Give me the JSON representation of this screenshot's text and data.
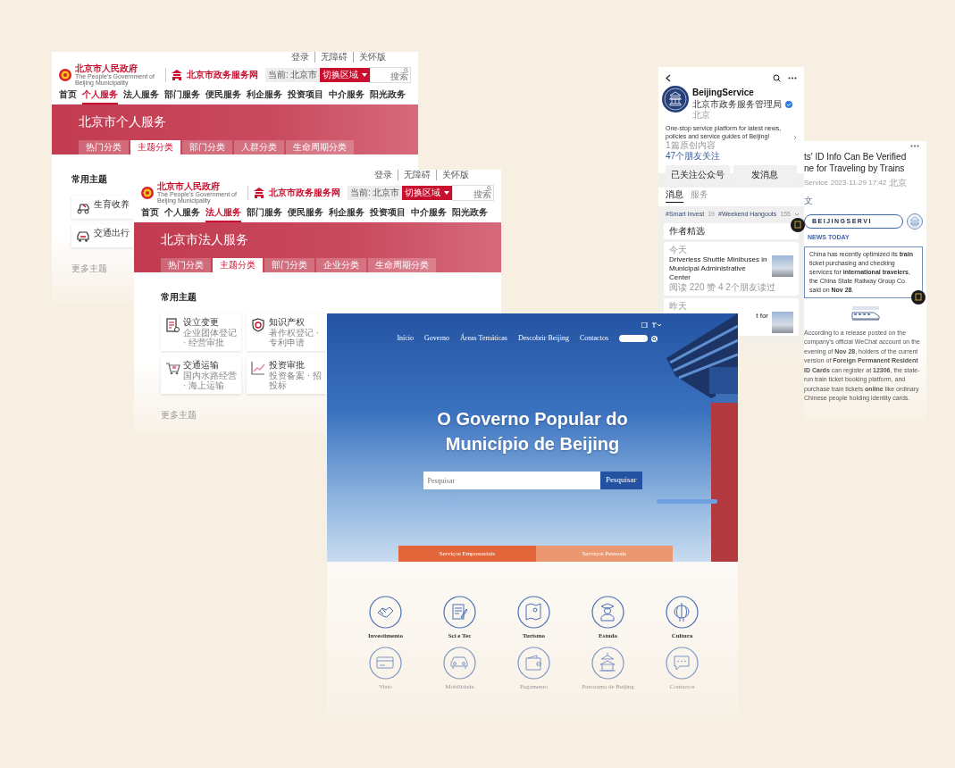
{
  "personal_portal": {
    "top_links": [
      "登录",
      "无障碍",
      "关怀版"
    ],
    "gov_name": "北京市人民政府",
    "gov_name_en": "The People's Government of Beijing Municipality",
    "service_name": "北京市政务服务网",
    "region_label": "当前: 北京市",
    "region_button": "切换区域",
    "search_label": "搜索",
    "nav": [
      {
        "label": "首页",
        "selected": false
      },
      {
        "label": "个人服务",
        "selected": true
      },
      {
        "label": "法人服务",
        "selected": false
      },
      {
        "label": "部门服务",
        "selected": false
      },
      {
        "label": "便民服务",
        "selected": false
      },
      {
        "label": "利企服务",
        "selected": false
      },
      {
        "label": "投资项目",
        "selected": false
      },
      {
        "label": "中介服务",
        "selected": false
      },
      {
        "label": "阳光政务",
        "selected": false
      }
    ],
    "banner_title": "北京市个人服务",
    "tabs": [
      {
        "label": "热门分类",
        "selected": false
      },
      {
        "label": "主题分类",
        "selected": true
      },
      {
        "label": "部门分类",
        "selected": false
      },
      {
        "label": "人群分类",
        "selected": false
      },
      {
        "label": "生命周期分类",
        "selected": false
      }
    ],
    "section_title": "常用主题",
    "topics": [
      {
        "title": "生育收养"
      },
      {
        "title": "交通出行"
      }
    ],
    "more_link": "更多主题"
  },
  "legal_portal": {
    "top_links": [
      "登录",
      "无障碍",
      "关怀版"
    ],
    "gov_name": "北京市人民政府",
    "gov_name_en": "The People's Government of Beijing Municipality",
    "service_name": "北京市政务服务网",
    "region_label": "当前: 北京市",
    "region_button": "切换区域",
    "search_label": "搜索",
    "nav": [
      {
        "label": "首页",
        "selected": false
      },
      {
        "label": "个人服务",
        "selected": false
      },
      {
        "label": "法人服务",
        "selected": true
      },
      {
        "label": "部门服务",
        "selected": false
      },
      {
        "label": "便民服务",
        "selected": false
      },
      {
        "label": "利企服务",
        "selected": false
      },
      {
        "label": "投资项目",
        "selected": false
      },
      {
        "label": "中介服务",
        "selected": false
      },
      {
        "label": "阳光政务",
        "selected": false
      }
    ],
    "banner_title": "北京市法人服务",
    "tabs": [
      {
        "label": "热门分类",
        "selected": false
      },
      {
        "label": "主题分类",
        "selected": true
      },
      {
        "label": "部门分类",
        "selected": false
      },
      {
        "label": "企业分类",
        "selected": false
      },
      {
        "label": "生命周期分类",
        "selected": false
      }
    ],
    "section_title": "常用主题",
    "topics": [
      {
        "title": "设立变更",
        "subtitle": "企业团体登记 · 经营审批"
      },
      {
        "title": "知识产权",
        "subtitle": "著作权登记 · 专利申请"
      },
      {
        "title": "交通运输",
        "subtitle": "国内水路经营 · 海上运输"
      },
      {
        "title": "投资审批",
        "subtitle": "投资备案 · 招投标"
      }
    ],
    "more_link": "更多主题"
  },
  "wechat_profile": {
    "name": "BeijingService",
    "org": "北京市政务服务管理局",
    "verified": true,
    "location": "北京",
    "description": "One-stop service platform for latest news, policies and service guides of Beijing!",
    "original_count": "1篇原创内容",
    "friends_following": "47个朋友关注",
    "buttons": [
      "已关注公众号",
      "发消息"
    ],
    "tabs": [
      {
        "label": "消息",
        "selected": true
      },
      {
        "label": "服务",
        "selected": false
      }
    ],
    "tags": [
      {
        "label": "#Smart Invest",
        "count": "19"
      },
      {
        "label": "#Weekend Hangouts",
        "count": "155"
      }
    ],
    "featured": "作者精选",
    "groups": [
      {
        "date": "今天",
        "title": "Driverless Shuttle Minibuses in Municipal Administrative Center",
        "meta": "阅读 220  赞 4  2个朋友读过"
      },
      {
        "date": "昨天",
        "title": "t for"
      }
    ]
  },
  "article": {
    "title_lines": [
      "ts' ID Info Can Be Verified",
      "ne for Traveling by Trains"
    ],
    "author": "Service",
    "time": "2023-11-29 17:42",
    "location": "北京",
    "original_mark": "文",
    "banner_text": "BEIJINGSERVI",
    "section": "NEWS TODAY",
    "lead": "China has recently optimized its **train** ticket purchasing and checking services for **international travelers**, the China State Railway Group Co. said on **Nov 28**.",
    "body": "According to a release posted on the company's official WeChat account on the evening of **Nov 28**, holders of the current version of **Foreign Permanent Resident ID Cards** can register at **12306**, the state-run train ticket booking platform, and purchase train tickets **online** like ordinary Chinese people holding identity cards."
  },
  "portuguese_site": {
    "nav": [
      "Início",
      "Governo",
      "Áreas Temáticas",
      "Descobrir Beijing",
      "Contactos"
    ],
    "headline": "O Governo Popular do Município de Beijing",
    "search": {
      "placeholder": "Pesquisar",
      "button": "Pesquisar"
    },
    "service_tabs": [
      {
        "label": "Serviços Empresariais",
        "selected": true
      },
      {
        "label": "Serviços Pessoais",
        "selected": false
      }
    ],
    "services": [
      {
        "label": "Investimento"
      },
      {
        "label": "Sci e Tec"
      },
      {
        "label": "Turismo"
      },
      {
        "label": "Estudo"
      },
      {
        "label": "Cultura"
      },
      {
        "label": "Visto"
      },
      {
        "label": "Mobilidade"
      },
      {
        "label": "Pagamento"
      },
      {
        "label": "Panorama de Beijing"
      },
      {
        "label": "Contactos"
      }
    ]
  }
}
